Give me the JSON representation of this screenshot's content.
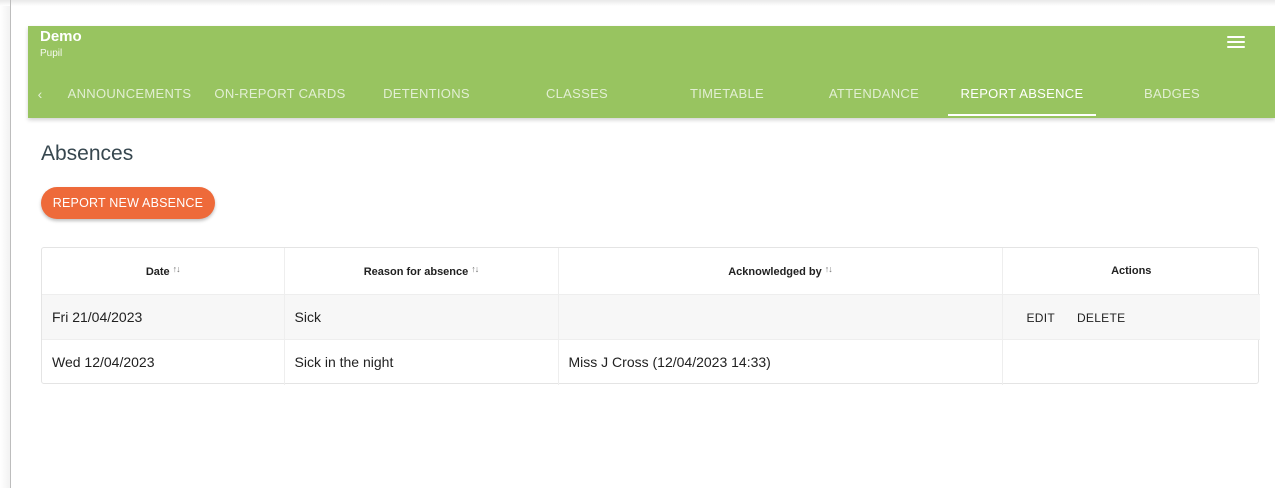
{
  "app": {
    "title": "Demo",
    "subtitle": "Pupil",
    "menu_icon": "hamburger-menu-icon",
    "accent_color": "#98c460"
  },
  "tabs": {
    "scroll_left_icon": "chevron-left-icon",
    "items": [
      {
        "label": "ANNOUNCEMENTS",
        "active": false
      },
      {
        "label": "ON-REPORT CARDS",
        "active": false
      },
      {
        "label": "DETENTIONS",
        "active": false
      },
      {
        "label": "CLASSES",
        "active": false
      },
      {
        "label": "TIMETABLE",
        "active": false
      },
      {
        "label": "ATTENDANCE",
        "active": false
      },
      {
        "label": "REPORT ABSENCE",
        "active": true
      },
      {
        "label": "BADGES",
        "active": false
      }
    ]
  },
  "main": {
    "title": "Absences",
    "report_button_label": "REPORT NEW ABSENCE",
    "report_button_color": "#ee6a3a"
  },
  "table": {
    "columns": [
      {
        "label": "Date",
        "sortable": true
      },
      {
        "label": "Reason for absence",
        "sortable": true
      },
      {
        "label": "Acknowledged by",
        "sortable": true
      },
      {
        "label": "Actions",
        "sortable": false
      }
    ],
    "sort_icon": "sort-arrows-icon",
    "sort_glyph": "↑↓",
    "rows": [
      {
        "date": "Fri 21/04/2023",
        "reason": "Sick",
        "acknowledged_by": "",
        "actions": [
          "EDIT",
          "DELETE"
        ]
      },
      {
        "date": "Wed 12/04/2023",
        "reason": "Sick in the night",
        "acknowledged_by": "Miss J Cross (12/04/2023 14:33)",
        "actions": []
      }
    ]
  }
}
